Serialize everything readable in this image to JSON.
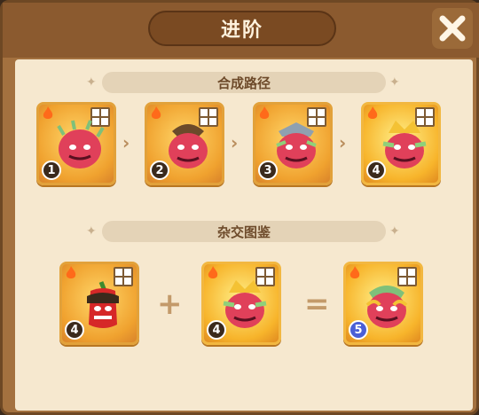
{
  "title": "进阶",
  "close_icon": "close-icon",
  "sections": {
    "path_label": "合成路径",
    "hybrid_label": "杂交图鉴"
  },
  "path": [
    {
      "level": "1",
      "tier": "normal"
    },
    {
      "level": "2",
      "tier": "normal"
    },
    {
      "level": "3",
      "tier": "normal"
    },
    {
      "level": "4",
      "tier": "gold"
    }
  ],
  "hybrid": {
    "input_a_level": "4",
    "input_b_level": "4",
    "result_level": "5",
    "plus": "+",
    "equals": "="
  },
  "colors": {
    "frame": "#8b5a2f",
    "parchment": "#f6e8cf",
    "card": "#f0a22f",
    "result_badge": "#4b5fd6"
  }
}
